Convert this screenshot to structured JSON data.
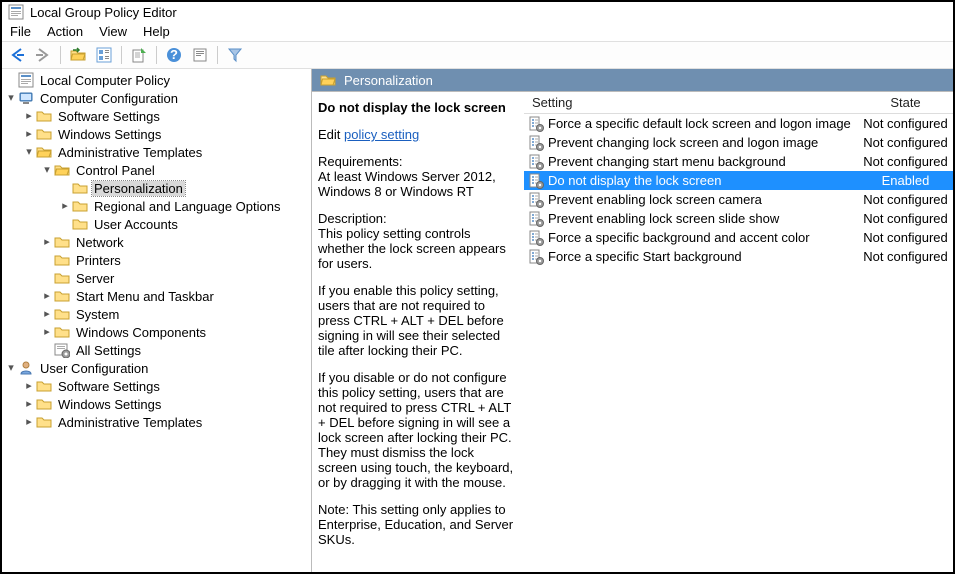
{
  "window": {
    "title": "Local Group Policy Editor"
  },
  "menu": {
    "file": "File",
    "action": "Action",
    "view": "View",
    "help": "Help"
  },
  "tree": {
    "root": "Local Computer Policy",
    "computer_cfg": "Computer Configuration",
    "cc_software": "Software Settings",
    "cc_windows": "Windows Settings",
    "cc_admin": "Administrative Templates",
    "cc_at_cp": "Control Panel",
    "cc_at_cp_pers": "Personalization",
    "cc_at_cp_reg": "Regional and Language Options",
    "cc_at_cp_user": "User Accounts",
    "cc_at_net": "Network",
    "cc_at_print": "Printers",
    "cc_at_srv": "Server",
    "cc_at_start": "Start Menu and Taskbar",
    "cc_at_sys": "System",
    "cc_at_wc": "Windows Components",
    "cc_at_allset": "All Settings",
    "user_cfg": "User Configuration",
    "uc_software": "Software Settings",
    "uc_windows": "Windows Settings",
    "uc_admin": "Administrative Templates"
  },
  "right": {
    "title": "Personalization",
    "setting_title": "Do not display the lock screen",
    "edit_text": "Edit",
    "edit_link": "policy setting",
    "req_label": "Requirements:",
    "req_body": "At least Windows Server 2012, Windows 8 or Windows RT",
    "desc_label": "Description:",
    "desc_body1": "This policy setting controls whether the lock screen appears for users.",
    "desc_body2": "If you enable this policy setting, users that are not required to press CTRL + ALT + DEL before signing in will see their selected tile after locking their PC.",
    "desc_body3": "If you disable or do not configure this policy setting, users that are not required to press CTRL + ALT + DEL before signing in will see a lock screen after locking their PC. They must dismiss the lock screen using touch, the keyboard, or by dragging it with the mouse.",
    "desc_body4": "Note: This setting only applies to Enterprise, Education, and Server SKUs."
  },
  "list": {
    "col_setting": "Setting",
    "col_state": "State",
    "items": [
      {
        "name": "Force a specific default lock screen and logon image",
        "state": "Not configured",
        "selected": false
      },
      {
        "name": "Prevent changing lock screen and logon image",
        "state": "Not configured",
        "selected": false
      },
      {
        "name": "Prevent changing start menu background",
        "state": "Not configured",
        "selected": false
      },
      {
        "name": "Do not display the lock screen",
        "state": "Enabled",
        "selected": true
      },
      {
        "name": "Prevent enabling lock screen camera",
        "state": "Not configured",
        "selected": false
      },
      {
        "name": "Prevent enabling lock screen slide show",
        "state": "Not configured",
        "selected": false
      },
      {
        "name": "Force a specific background and accent color",
        "state": "Not configured",
        "selected": false
      },
      {
        "name": "Force a specific Start background",
        "state": "Not configured",
        "selected": false
      }
    ]
  }
}
